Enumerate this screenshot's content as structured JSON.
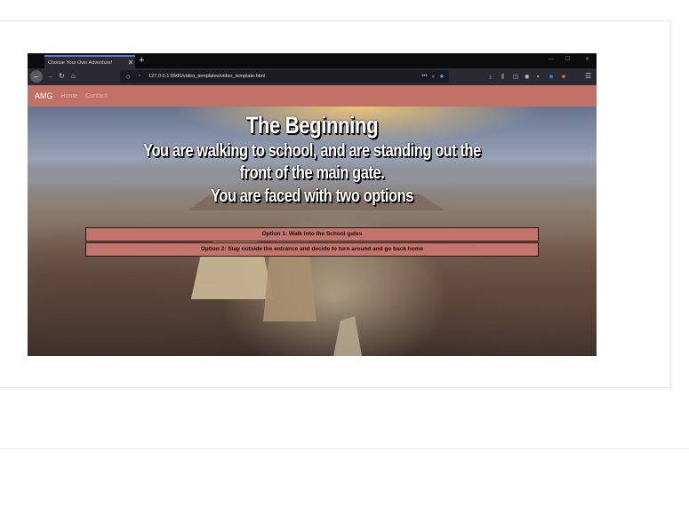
{
  "browser": {
    "tab": {
      "title": "Choose Your Own Adventure!",
      "close": "✕"
    },
    "new_tab": "+",
    "window_controls": {
      "minimize": "—",
      "maximize": "☐",
      "close": "✕"
    },
    "nav": {
      "back": "←",
      "forward": "→",
      "reload": "↻",
      "home": "⌂"
    },
    "address_bar": {
      "url": "127.0.0.1:5500/video_templates/video_template.html",
      "more": "•••"
    }
  },
  "site": {
    "brand": "AMG",
    "links": [
      "Home",
      "Contact"
    ],
    "nav_color": "#c17066"
  },
  "story": {
    "title": "The Beginning",
    "scene": "You are walking to school, and are standing out the front of the main gate.",
    "prompt": "You are faced with two options",
    "options": [
      "Option 1: Walk into the School gates",
      "Option 2: Stay outside the entrance and decide to turn around and go back home"
    ],
    "button_color": "#c1756d"
  }
}
